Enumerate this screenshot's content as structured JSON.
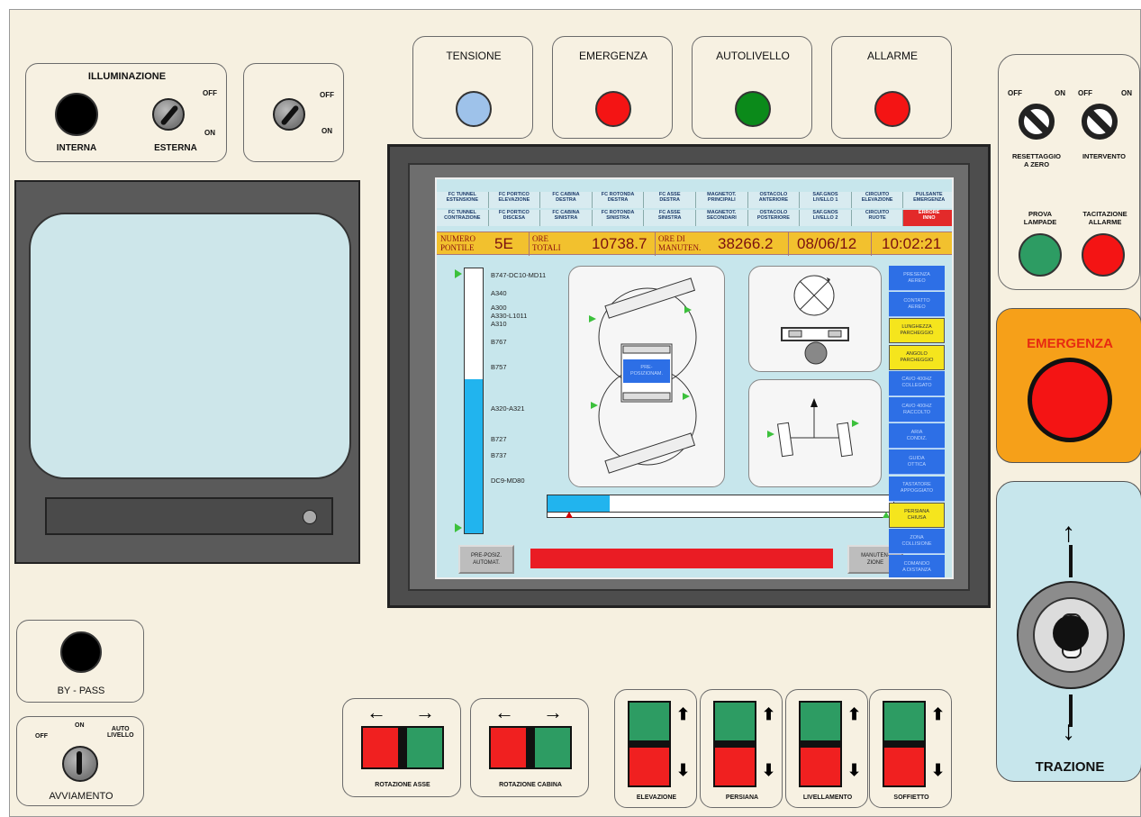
{
  "illuminazione": {
    "title": "ILLUMINAZIONE",
    "interna": "INTERNA",
    "esterna": "ESTERNA",
    "off": "OFF",
    "on": "ON"
  },
  "switch2": {
    "off": "OFF",
    "on": "ON"
  },
  "indicators": [
    {
      "label": "TENSIONE",
      "color": "#9ec2ea"
    },
    {
      "label": "EMERGENZA",
      "color": "#f41414"
    },
    {
      "label": "AUTOLIVELLO",
      "color": "#0b8a1a"
    },
    {
      "label": "ALLARME",
      "color": "#f41414"
    }
  ],
  "right_panel": {
    "off1": "OFF",
    "on1": "ON",
    "off2": "OFF",
    "on2": "ON",
    "reset_label": "RESETTAGGIO\nA ZERO",
    "intervento_label": "INTERVENTO",
    "prova_label": "PROVA\nLAMPADE",
    "tacitazione_label": "TACITAZIONE\nALLARME"
  },
  "emergenza_button": {
    "label": "EMERGENZA"
  },
  "trazione": {
    "label": "TRAZIONE"
  },
  "bypass": {
    "label": "BY - PASS"
  },
  "avviamento": {
    "label": "AVVIAMENTO",
    "off": "OFF",
    "on": "ON",
    "auto": "AUTO\nLIVELLO"
  },
  "bottom_switches": {
    "rot_asse": "ROTAZIONE ASSE",
    "rot_cabina": "ROTAZIONE CABINA",
    "elevazione": "ELEVAZIONE",
    "persiana": "PERSIANA",
    "livellamento": "LIVELLAMENTO",
    "soffietto": "SOFFIETTO"
  },
  "screen": {
    "signals_row1": [
      "FC TUNNEL\nESTENSIONE",
      "FC PORTICO\nELEVAZIONE",
      "FC CABINA\nDESTRA",
      "FC ROTONDA\nDESTRA",
      "FC ASSE\nDESTRA",
      "MAGNETOT.\nPRINCIPALI",
      "OSTACOLO\nANTERIORE",
      "SAF.GNOS\nLIVELLO 1",
      "CIRCUITO\nELEVAZIONE",
      "PULSANTE\nEMERGENZA"
    ],
    "signals_row2": [
      "FC TUNNEL\nCONTRAZIONE",
      "FC PORTICO\nDISCESA",
      "FC CABINA\nSINISTRA",
      "FC ROTONDA\nSINISTRA",
      "FC ASSE\nSINISTRA",
      "MAGNETOT.\nSECONDARI",
      "OSTACOLO\nPOSTERIORE",
      "SAF.GNOS\nLIVELLO 2",
      "CIRCUITO\nRUOTE",
      "ERRORE\nINNO"
    ],
    "numero_pontile_label": "NUMERO\nPONTILE",
    "numero_pontile": "5E",
    "ore_totali_label": "ORE\nTOTALI",
    "ore_totali": "10738.7",
    "ore_manut_label": "ORE DI\nMANUTEN.",
    "ore_manut": "38266.2",
    "date": "08/06/12",
    "time": "10:02:21",
    "aircraft": [
      "B747-DC10-MD11",
      "A340",
      "A300\nA330-L1011\nA310",
      "B767",
      "B757",
      "A320-A321",
      "B727",
      "B737",
      "DC9-MD80"
    ],
    "level_fill": 0.58,
    "extension_fill": 0.18,
    "pre_posiz_label": "PRE-\nPOSIZIONAM.",
    "side_buttons": [
      {
        "label": "PRESENZA\nAEREO",
        "state": "blue"
      },
      {
        "label": "CONTATTO\nAEREO",
        "state": "blue"
      },
      {
        "label": "LUNGHEZZA\nPARCHEGGIO",
        "state": "yellow"
      },
      {
        "label": "ANGOLO\nPARCHEGGIO",
        "state": "yellow"
      },
      {
        "label": "CAVO 400HZ\nCOLLEGATO",
        "state": "blue"
      },
      {
        "label": "CAVO 400HZ\nRACCOLTO",
        "state": "blue"
      },
      {
        "label": "ARIA\nCONDIZ.",
        "state": "blue"
      },
      {
        "label": "GUIDA\nOTTICA",
        "state": "blue"
      },
      {
        "label": "TASTATORE\nAPPOGGIATO",
        "state": "blue"
      },
      {
        "label": "PERSIANA\nCHIUSA",
        "state": "yellow"
      },
      {
        "label": "ZONA\nCOLLISIONE",
        "state": "blue"
      },
      {
        "label": "COMANDO\nA DISTANZA",
        "state": "blue"
      }
    ],
    "btn_pre_posiz": "PRE-POSIZ.\nAUTOMAT.",
    "btn_manut": "MANUTEN-\nZIONE"
  }
}
